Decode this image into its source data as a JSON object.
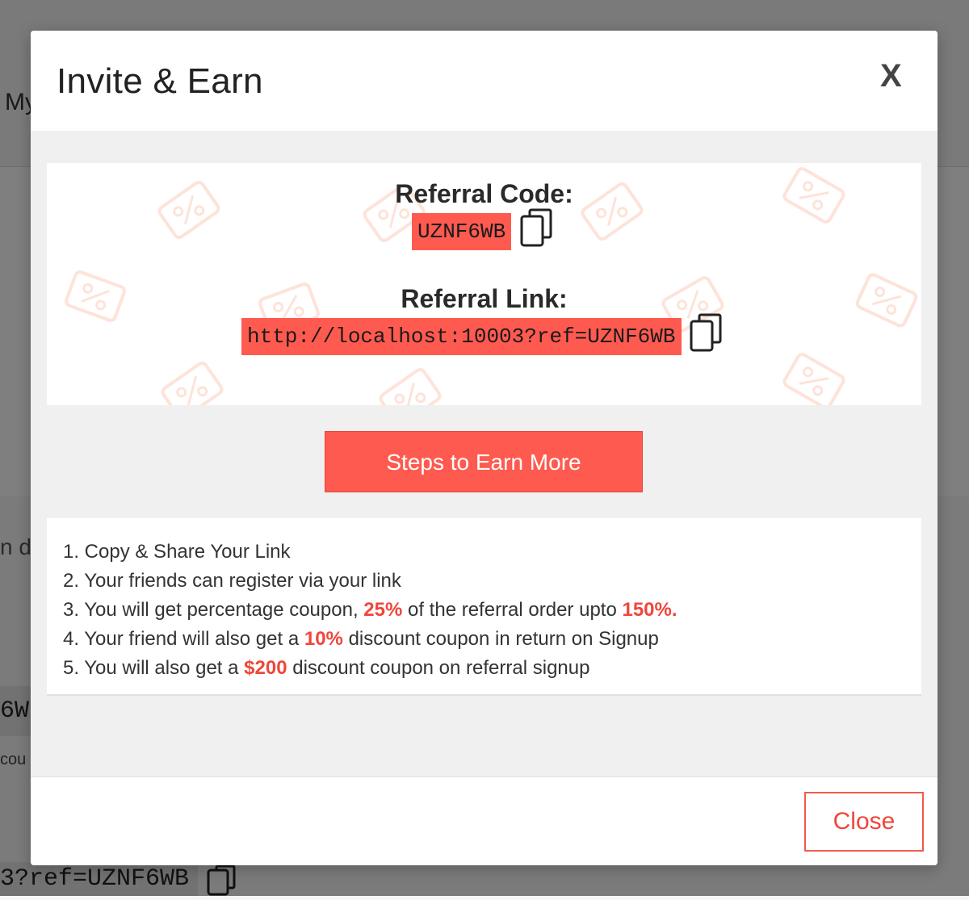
{
  "background": {
    "nav_text": "My",
    "partial_text": "n d",
    "code_fragment": "6W",
    "coupon_fragment": "cou",
    "link_fragment": "3?ref=UZNF6WB"
  },
  "modal": {
    "title": "Invite & Earn",
    "close_x": "X",
    "referral_code_label": "Referral Code:",
    "referral_code": "UZNF6WB",
    "referral_link_label": "Referral Link:",
    "referral_link": "http://localhost:10003?ref=UZNF6WB",
    "copy_icon": "copy-icon",
    "steps_button": "Steps to Earn More",
    "steps": [
      {
        "before": "1. Copy & Share Your Link",
        "highlight": "",
        "after": "",
        "highlight2": ""
      },
      {
        "before": "2. Your friends can register via your link",
        "highlight": "",
        "after": "",
        "highlight2": ""
      },
      {
        "before": "3. You will get percentage coupon, ",
        "highlight": "25%",
        "after": " of the referral order upto ",
        "highlight2": "150%."
      },
      {
        "before": "4. Your friend will also get a ",
        "highlight": "10%",
        "after": " discount coupon in return on Signup",
        "highlight2": ""
      },
      {
        "before": "5. You will also get a ",
        "highlight": "$200",
        "after": " discount coupon on referral signup",
        "highlight2": ""
      }
    ],
    "close_button": "Close"
  },
  "colors": {
    "accent": "#ff5a4f",
    "accent_text": "#f0463b",
    "overlay": "rgba(0,0,0,0.5)"
  }
}
